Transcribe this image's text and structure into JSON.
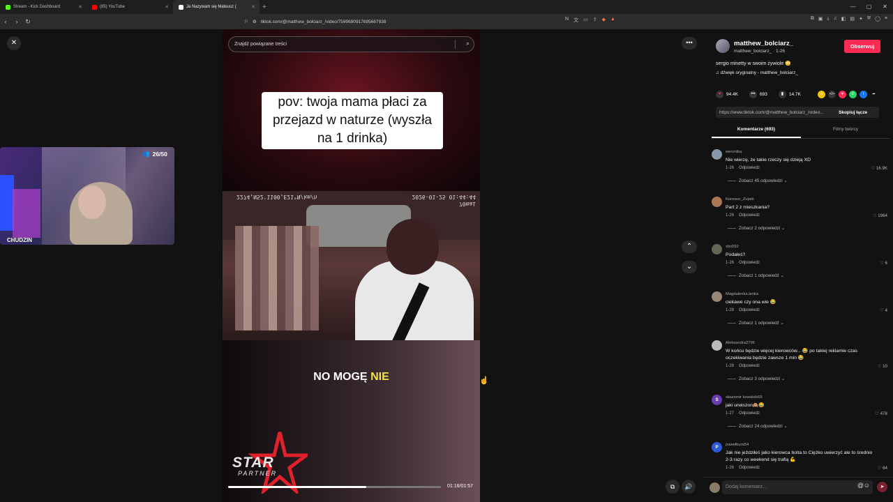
{
  "browser": {
    "tabs": [
      {
        "label": "Stream - Kick Dashboard",
        "color": "#53fc18"
      },
      {
        "label": "(85) YouTube",
        "color": "#ff0000"
      },
      {
        "label": "Ja Nazywam się Mateusz (",
        "color": "#ffffff"
      }
    ],
    "new_tab": "+",
    "url": "tiktok.com/@matthew_bolciarz_/video/7599690917695687938"
  },
  "webcam": {
    "viewers": "26/50",
    "streamer_name": "CHUDZIN"
  },
  "video": {
    "search_placeholder": "Znajdź powiązane treści",
    "caption": "pov: twoja mama płaci za przejazd w naturze (wyszła na 1 drinka)",
    "dashcam_left": "2026-01-25 01:44:44",
    "dashcam_right": "2274,N52'1100,E21°N/km/h",
    "dashcam_brand": "70mai",
    "subtitle_main": "NO MOGĘ",
    "subtitle_highlight": "NIE",
    "logo_star": "STAR",
    "logo_partner": "PARTNER",
    "time": "01:16/01:57",
    "progress": 0.65
  },
  "sidebar": {
    "author_name": "matthew_bolciarz_",
    "author_sub": "matthew_bolciarz_ · 1-26",
    "follow_label": "Obserwuj",
    "description": "sergio minetty w swoim żywiole 😳",
    "sound": "♫  dźwięk oryginalny - matthew_bolciarz_",
    "likes": "94.4K",
    "comments_count": "693",
    "saves": "14.7K",
    "link": "https://www.tiktok.com/@matthew_bolciarz_/video...",
    "copy_label": "Skopiuj łącze",
    "tab_comments": "Komentarze (693)",
    "tab_creator": "Filmy twórcy",
    "comments": [
      {
        "user": "weronika",
        "text": "Nie wierzę, że takie rzeczy się dzieją XD",
        "date": "1-26",
        "reply": "Odpowiedz",
        "likes": "♡ 16.9K",
        "more": "Zobacz 45 odpowiedzi ⌄",
        "avatar": "",
        "color": "#8899aa"
      },
      {
        "user": "Koneser_Zupek",
        "text": "Part 2 z mieszkania?",
        "date": "1-26",
        "reply": "Odpowiedz",
        "likes": "♡ 1964",
        "more": "Zobacz 2 odpowiedzi ⌄",
        "avatar": "",
        "color": "#aa7755"
      },
      {
        "user": "xbx092",
        "text": "Podałeś?",
        "date": "1-26",
        "reply": "Odpowiedz",
        "likes": "♡ 6",
        "more": "Zobacz 1 odpowiedź ⌄",
        "avatar": "",
        "color": "#666655"
      },
      {
        "user": "Magdalenka.lenka",
        "text": "ciekawe czy ona wie 😂",
        "date": "1-28",
        "reply": "Odpowiedz",
        "likes": "♡ 4",
        "more": "Zobacz 1 odpowiedź ⌄",
        "avatar": "",
        "color": "#998877"
      },
      {
        "user": "Aleksandra2796",
        "text": "W końcu będzie więcej kierowców... 😂 po takiej reklamie czas oczekiwania będzie zawsze 1 min 😂",
        "date": "1-28",
        "reply": "Odpowiedz",
        "likes": "♡ 10",
        "more": "Zobacz 3 odpowiedzi ⌄",
        "avatar": "",
        "color": "#bbbbbb"
      },
      {
        "user": "sławomir kowalski65",
        "text": "jaki urwiszon🙈😂",
        "date": "1-27",
        "reply": "Odpowiedz",
        "likes": "♡ 478",
        "more": "Zobacz 24 odpowiedzi ⌄",
        "avatar": "S",
        "color": "#6a3bb0"
      },
      {
        "user": "pawełbura54",
        "text": "Jak nie jeździłeś jako kierowca bolta to Ciężko uwierzyć ale to średnio 2-3 razy co weekend się trafią 💪",
        "date": "1-26",
        "reply": "Odpowiedz",
        "likes": "♡ 64",
        "more": "",
        "avatar": "P",
        "color": "#2a5ad8"
      }
    ],
    "composer_placeholder": "Dodaj komentarz...",
    "at_sign": "@",
    "emoji": "☺",
    "send": "➤"
  }
}
